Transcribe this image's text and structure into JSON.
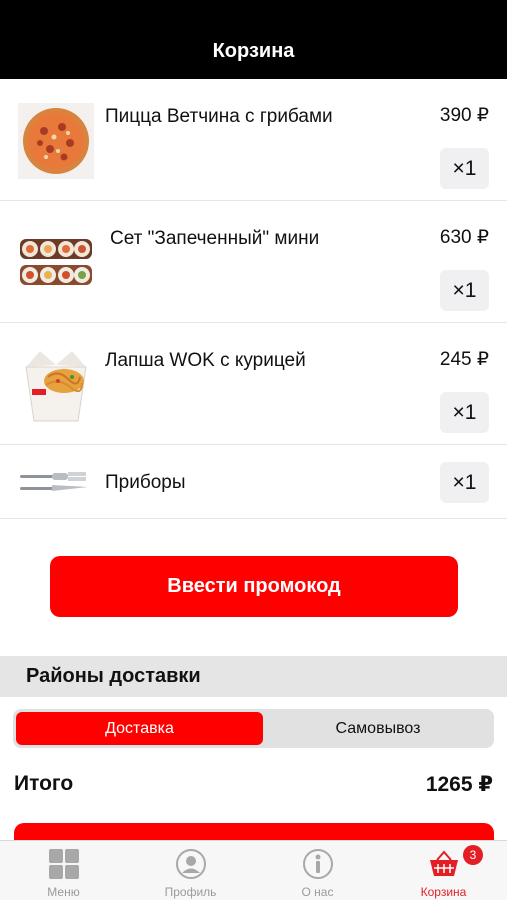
{
  "header": {
    "title": "Корзина"
  },
  "cart": {
    "items": [
      {
        "name": "Пицца Ветчина с грибами",
        "price": "390 ₽",
        "qty": "×1",
        "icon": "pizza-image"
      },
      {
        "name": "Сет \"Запеченный\" мини",
        "price": "630 ₽",
        "qty": "×1",
        "icon": "sushi-set-image"
      },
      {
        "name": "Лапша WOK с курицей",
        "price": "245 ₽",
        "qty": "×1",
        "icon": "wok-box-image"
      },
      {
        "name": "Приборы",
        "price": "",
        "qty": "×1",
        "icon": "cutlery-image"
      }
    ]
  },
  "promo": {
    "button_label": "Ввести промокод"
  },
  "delivery": {
    "section_title": "Районы доставки",
    "options": [
      "Доставка",
      "Самовывоз"
    ],
    "selected": "Доставка"
  },
  "total": {
    "label": "Итого",
    "value": "1265 ₽"
  },
  "tabbar": {
    "tabs": [
      {
        "label": "Меню",
        "icon": "grid-icon"
      },
      {
        "label": "Профиль",
        "icon": "profile-icon"
      },
      {
        "label": "О нас",
        "icon": "info-icon"
      },
      {
        "label": "Корзина",
        "icon": "basket-icon",
        "badge": "3"
      }
    ],
    "active": "Корзина"
  },
  "colors": {
    "accent": "#ff0000",
    "header_bg": "#000000",
    "tab_active": "#e31e24"
  }
}
